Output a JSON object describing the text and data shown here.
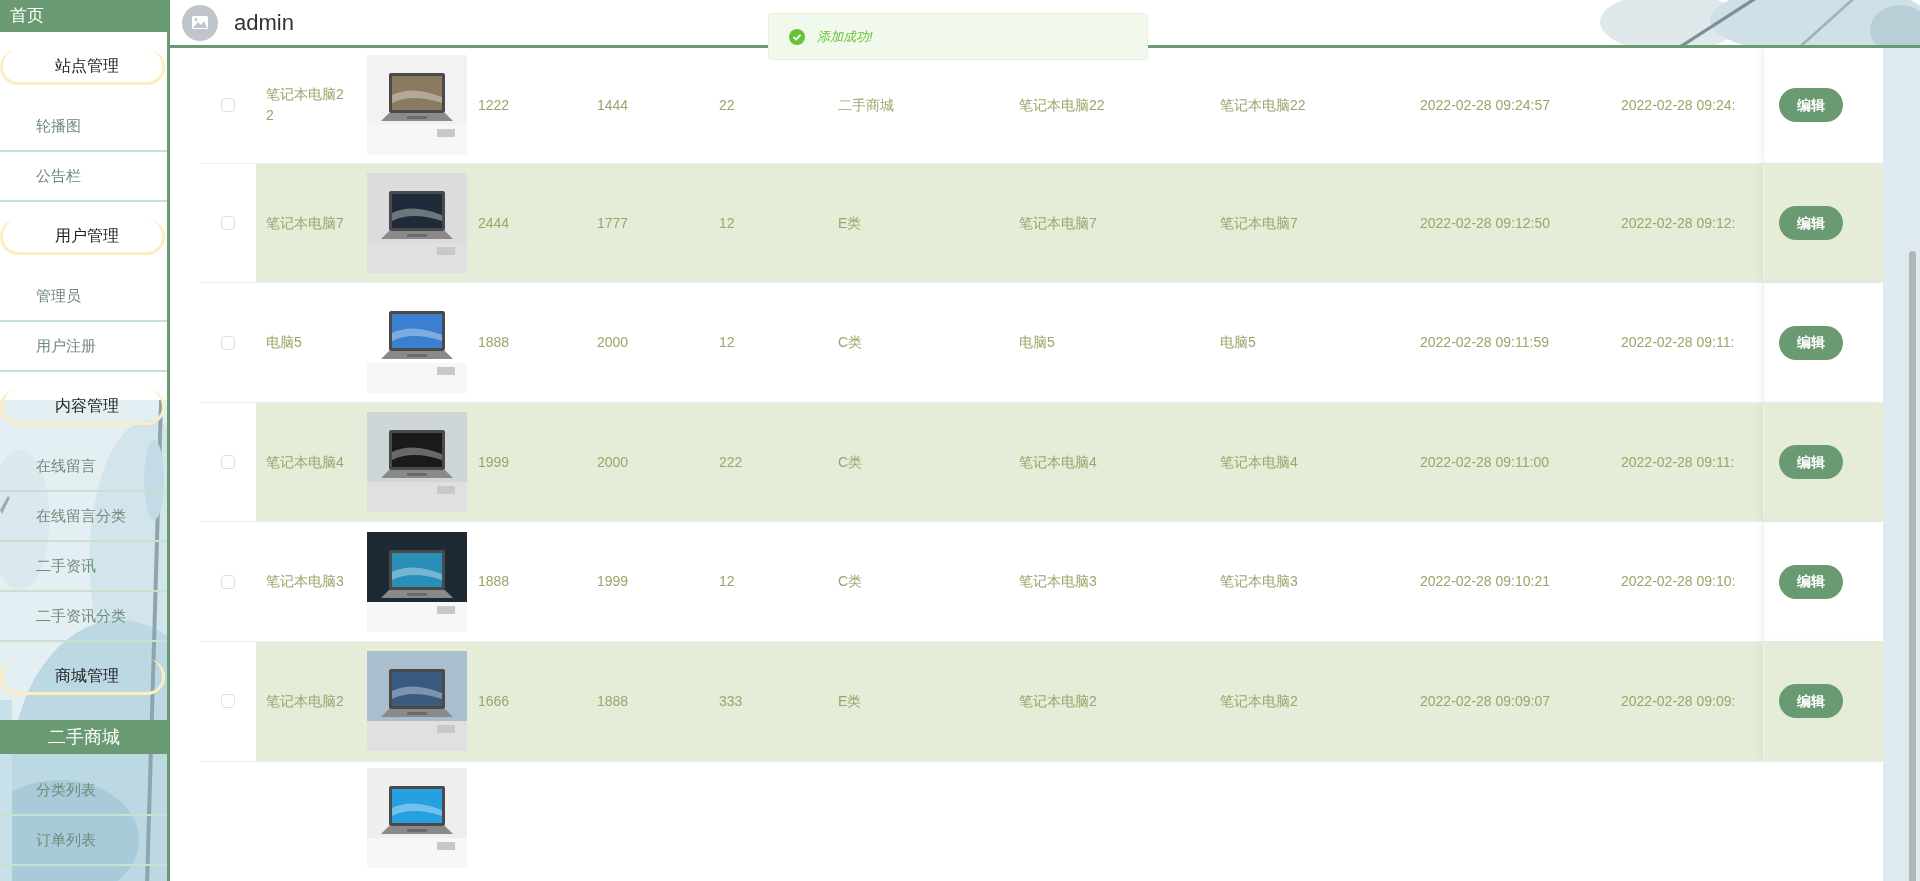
{
  "sidebar": {
    "items": [
      {
        "kind": "home",
        "label": "首页"
      },
      {
        "kind": "group",
        "label": "站点管理"
      },
      {
        "kind": "link",
        "label": "轮播图"
      },
      {
        "kind": "link",
        "label": "公告栏"
      },
      {
        "kind": "group",
        "label": "用户管理"
      },
      {
        "kind": "link",
        "label": "管理员"
      },
      {
        "kind": "link",
        "label": "用户注册"
      },
      {
        "kind": "group",
        "label": "内容管理"
      },
      {
        "kind": "link",
        "label": "在线留言"
      },
      {
        "kind": "link",
        "label": "在线留言分类"
      },
      {
        "kind": "link",
        "label": "二手资讯"
      },
      {
        "kind": "link",
        "label": "二手资讯分类"
      },
      {
        "kind": "group",
        "label": "商城管理"
      },
      {
        "kind": "subgroup",
        "label": "二手商城"
      },
      {
        "kind": "link",
        "label": "分类列表"
      },
      {
        "kind": "link",
        "label": "订单列表"
      }
    ]
  },
  "header": {
    "user": "admin"
  },
  "toast": {
    "kind": "success",
    "message": "添加成功!"
  },
  "table": {
    "rows": [
      {
        "checked": false,
        "name": "笔记本电脑22",
        "column_3": "1222",
        "column_4": "1444",
        "column_5": "22",
        "column_6": "二手商城",
        "column_7": "笔记本电脑22",
        "column_8": "笔记本电脑22",
        "column_9": "2022-02-28 09:24:57",
        "column_10": "2022-02-28 09:24:",
        "action": "编辑"
      },
      {
        "checked": false,
        "name": "笔记本电脑7",
        "column_3": "2444",
        "column_4": "1777",
        "column_5": "12",
        "column_6": "E类",
        "column_7": "笔记本电脑7",
        "column_8": "笔记本电脑7",
        "column_9": "2022-02-28 09:12:50",
        "column_10": "2022-02-28 09:12:",
        "action": "编辑"
      },
      {
        "checked": false,
        "name": "电脑5",
        "column_3": "1888",
        "column_4": "2000",
        "column_5": "12",
        "column_6": "C类",
        "column_7": "电脑5",
        "column_8": "电脑5",
        "column_9": "2022-02-28 09:11:59",
        "column_10": "2022-02-28 09:11:",
        "action": "编辑"
      },
      {
        "checked": false,
        "name": "笔记本电脑4",
        "column_3": "1999",
        "column_4": "2000",
        "column_5": "222",
        "column_6": "C类",
        "column_7": "笔记本电脑4",
        "column_8": "笔记本电脑4",
        "column_9": "2022-02-28 09:11:00",
        "column_10": "2022-02-28 09:11:",
        "action": "编辑"
      },
      {
        "checked": false,
        "name": "笔记本电脑3",
        "column_3": "1888",
        "column_4": "1999",
        "column_5": "12",
        "column_6": "C类",
        "column_7": "笔记本电脑3",
        "column_8": "笔记本电脑3",
        "column_9": "2022-02-28 09:10:21",
        "column_10": "2022-02-28 09:10:",
        "action": "编辑"
      },
      {
        "checked": false,
        "name": "笔记本电脑2",
        "column_3": "1666",
        "column_4": "1888",
        "column_5": "333",
        "column_6": "E类",
        "column_7": "笔记本电脑2",
        "column_8": "笔记本电脑2",
        "column_9": "2022-02-28 09:09:07",
        "column_10": "2022-02-28 09:09:",
        "action": "编辑"
      }
    ]
  }
}
